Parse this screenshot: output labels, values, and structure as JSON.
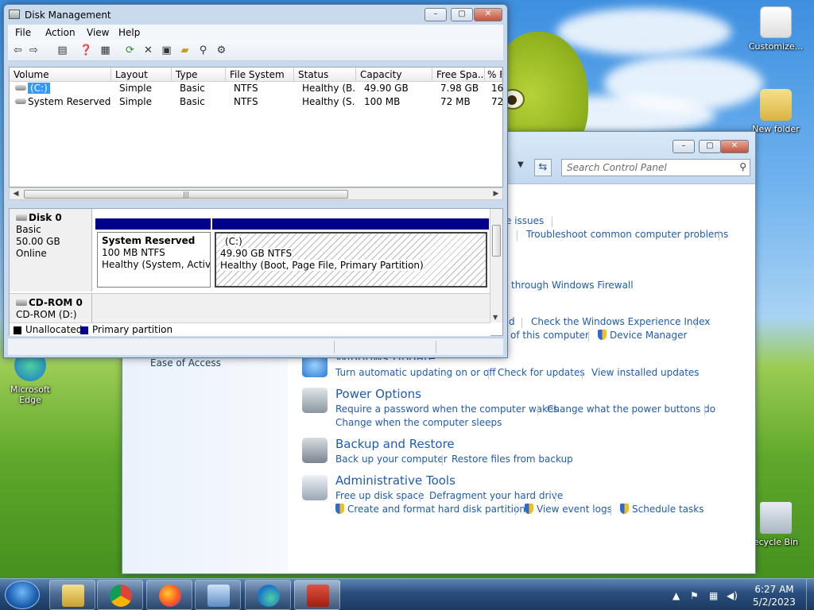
{
  "desktop": {
    "icons": [
      {
        "label": "Customize..."
      },
      {
        "label": "New folder"
      },
      {
        "label": "Microsoft Edge"
      },
      {
        "label": "ecycle Bin"
      }
    ]
  },
  "control_panel": {
    "search_placeholder": "Search Control Panel",
    "sidebar_link": "Ease of Access",
    "links": {
      "issues": "e issues",
      "troubleshoot": "Troubleshoot common computer problems",
      "firewall": "through Windows Firewall",
      "d": "d",
      "experience_index": "Check the Windows Experience Index",
      "of_computer": "of this computer",
      "device_manager": "Device Manager"
    },
    "categories": {
      "windows_update": {
        "title": "Windows Update",
        "links": [
          "Turn automatic updating on or off",
          "Check for updates",
          "View installed updates"
        ]
      },
      "power_options": {
        "title": "Power Options",
        "links": [
          "Require a password when the computer wakes",
          "Change what the power buttons do",
          "Change when the computer sleeps"
        ]
      },
      "backup_restore": {
        "title": "Backup and Restore",
        "links": [
          "Back up your computer",
          "Restore files from backup"
        ]
      },
      "admin_tools": {
        "title": "Administrative Tools",
        "links": [
          "Free up disk space",
          "Defragment your hard drive",
          "Create and format hard disk partitions",
          "View event logs",
          "Schedule tasks"
        ]
      }
    }
  },
  "disk_management": {
    "title": "Disk Management",
    "menu": [
      "File",
      "Action",
      "View",
      "Help"
    ],
    "columns": [
      "Volume",
      "Layout",
      "Type",
      "File System",
      "Status",
      "Capacity",
      "Free Spa...",
      "% F"
    ],
    "rows": [
      {
        "volume": "(C:)",
        "layout": "Simple",
        "type": "Basic",
        "fs": "NTFS",
        "status": "Healthy (B...",
        "capacity": "49.90 GB",
        "free": "7.98 GB",
        "pct": "16"
      },
      {
        "volume": "System Reserved",
        "layout": "Simple",
        "type": "Basic",
        "fs": "NTFS",
        "status": "Healthy (S...",
        "capacity": "100 MB",
        "free": "72 MB",
        "pct": "72"
      }
    ],
    "disk0": {
      "name": "Disk 0",
      "type": "Basic",
      "size": "50.00 GB",
      "state": "Online",
      "partitions": [
        {
          "name": "System Reserved",
          "size": "100 MB NTFS",
          "status": "Healthy (System, Active,"
        },
        {
          "name": "(C:)",
          "size": "49.90 GB NTFS",
          "status": "Healthy (Boot, Page File, Primary Partition)"
        }
      ]
    },
    "cdrom0": {
      "name": "CD-ROM 0",
      "sub": "CD-ROM (D:)"
    },
    "legend": [
      "Unallocated",
      "Primary partition"
    ],
    "colors": {
      "unallocated": "#000000",
      "primary": "#00008b"
    }
  },
  "taskbar": {
    "time": "6:27 AM",
    "date": "5/2/2023",
    "apps": [
      "file-explorer-icon",
      "chrome-icon",
      "firefox-icon",
      "control-panel-icon",
      "edge-icon",
      "toolbox-icon"
    ]
  }
}
